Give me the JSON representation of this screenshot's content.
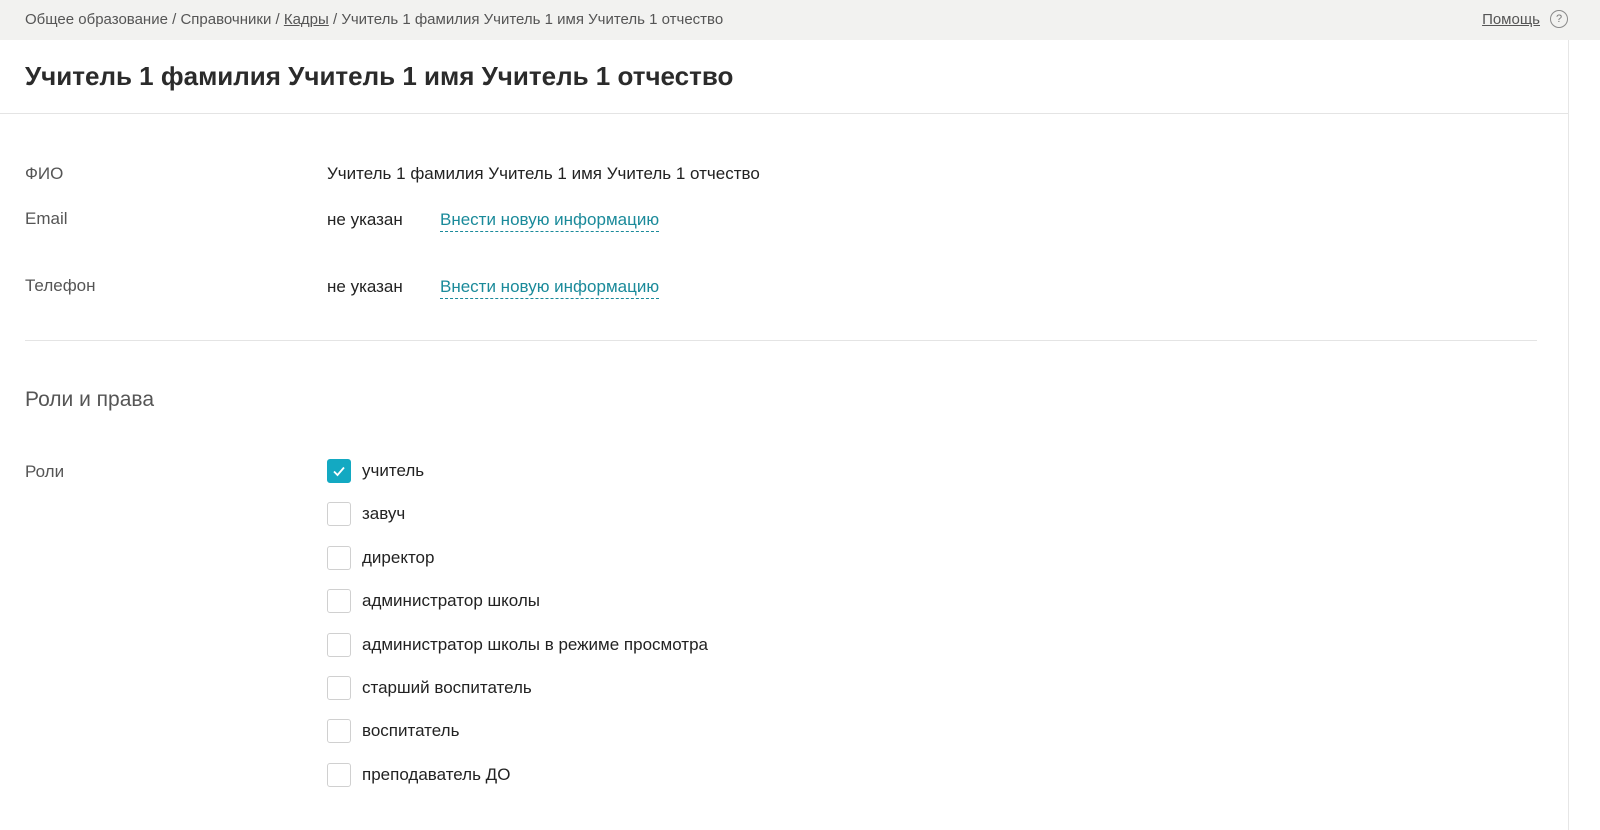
{
  "breadcrumb": {
    "items": [
      "Общее образование",
      "Справочники",
      "Кадры",
      "Учитель 1 фамилия Учитель 1 имя Учитель 1 отчество"
    ],
    "separator": "/"
  },
  "help": {
    "label": "Помощь",
    "icon_glyph": "?",
    "icon": "help-circle-icon"
  },
  "page": {
    "title": "Учитель 1 фамилия Учитель 1 имя Учитель 1 отчество"
  },
  "fields": {
    "fio": {
      "label": "ФИО",
      "value": "Учитель 1 фамилия Учитель 1 имя Учитель 1 отчество"
    },
    "email": {
      "label": "Email",
      "value": "не указан",
      "action": "Внести новую информацию"
    },
    "phone": {
      "label": "Телефон",
      "value": "не указан",
      "action": "Внести новую информацию"
    }
  },
  "roles_section": {
    "title": "Роли и права",
    "roles_label": "Роли",
    "roles": [
      {
        "label": "учитель",
        "checked": true
      },
      {
        "label": "завуч",
        "checked": false
      },
      {
        "label": "директор",
        "checked": false
      },
      {
        "label": "администратор школы",
        "checked": false
      },
      {
        "label": "администратор школы в режиме просмотра",
        "checked": false
      },
      {
        "label": "старший воспитатель",
        "checked": false
      },
      {
        "label": "воспитатель",
        "checked": false
      },
      {
        "label": "преподаватель ДО",
        "checked": false
      }
    ]
  },
  "colors": {
    "accent": "#13a9c2",
    "link": "#1a8a9a",
    "topbar_bg": "#f2f2f0"
  }
}
